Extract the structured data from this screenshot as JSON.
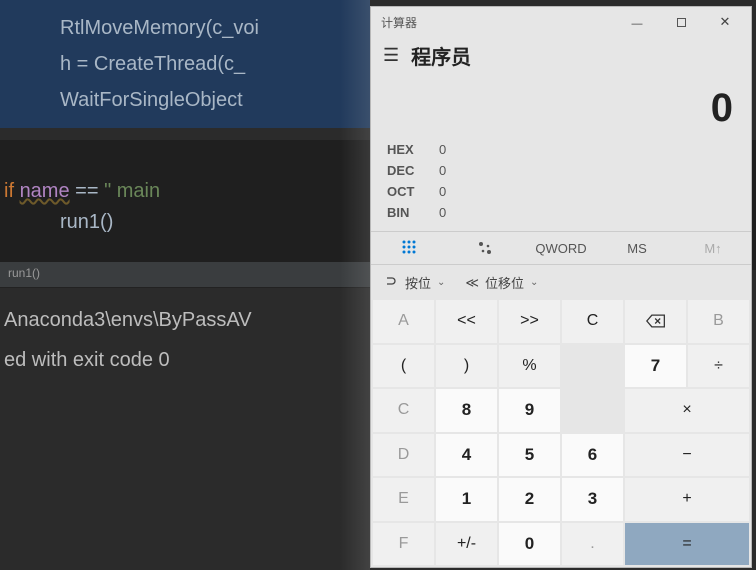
{
  "ide": {
    "code_lines": [
      "RtlMoveMemory(c_voi",
      "h = CreateThread(c_",
      "WaitForSingleObject"
    ],
    "if_kw": "if",
    "if_name_l": "name",
    "if_eq": "==",
    "if_str": "\"  main  ",
    "run_call": "run1()",
    "tab_label": "run1()",
    "console_lines": [
      "Anaconda3\\envs\\ByPassAV",
      "",
      "ed with exit code 0"
    ]
  },
  "calc": {
    "window_title": "计算器",
    "mode": "程序员",
    "display_value": "0",
    "bases": [
      {
        "label": "HEX",
        "value": "0"
      },
      {
        "label": "DEC",
        "value": "0"
      },
      {
        "label": "OCT",
        "value": "0"
      },
      {
        "label": "BIN",
        "value": "0"
      }
    ],
    "toolbar": {
      "qword": "QWORD",
      "ms": "MS",
      "mup": "M↑"
    },
    "shift": {
      "bitwise_label": "按位",
      "bitshift_label": "位移位"
    },
    "keys": {
      "A": "A",
      "B": "B",
      "C": "C",
      "D": "D",
      "E": "E",
      "F": "F",
      "shl": "<<",
      "shr": ">>",
      "clear": "C",
      "lp": "(",
      "rp": ")",
      "pct": "%",
      "7": "7",
      "8": "8",
      "9": "9",
      "4": "4",
      "5": "5",
      "6": "6",
      "1": "1",
      "2": "2",
      "3": "3",
      "pm": "+/-",
      "0": "0",
      "dot": ".",
      "div": "÷",
      "mul": "×",
      "sub": "−",
      "add": "+",
      "eq": "="
    }
  }
}
